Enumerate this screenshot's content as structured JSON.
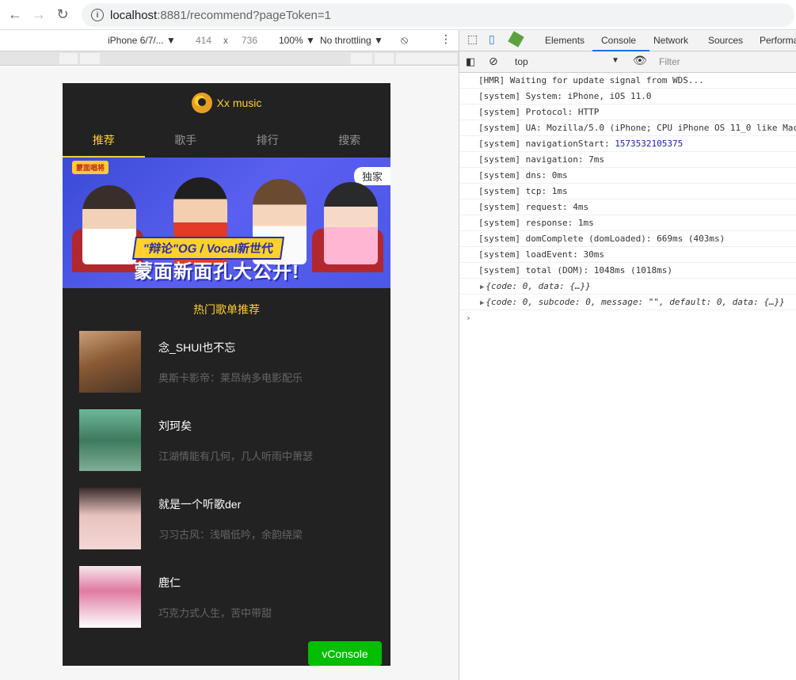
{
  "browser": {
    "url_host": "localhost",
    "url_rest": ":8881/recommend?pageToken=1"
  },
  "device_toolbar": {
    "device": "iPhone 6/7/...",
    "width": "414",
    "times": "x",
    "height": "736",
    "zoom": "100%",
    "throttle": "No throttling"
  },
  "devtools": {
    "tabs": [
      "Elements",
      "Console",
      "Network",
      "Sources",
      "Performa"
    ],
    "active_tab": "Console",
    "context": "top",
    "filter_placeholder": "Filter"
  },
  "console_lines": [
    "[HMR] Waiting for update signal from WDS...",
    "[system] System: iPhone, iOS 11.0",
    "[system] Protocol: HTTP",
    "[system] UA: Mozilla/5.0 (iPhone; CPU iPhone OS 11_0 like Mac",
    "[system] navigationStart: ",
    "[system] navigation: 7ms",
    "[system] dns: 0ms",
    "[system] tcp: 1ms",
    "[system] request: 4ms",
    "[system] response: 1ms",
    "[system] domComplete (domLoaded): 669ms (403ms)",
    "[system] loadEvent: 30ms",
    "[system] total (DOM): 1048ms (1018ms)"
  ],
  "navigation_start_value": "1573532105375",
  "console_obj1": "{code: 0, data: {…}}",
  "console_obj2": "{code: 0, subcode: 0, message: \"\", default: 0, data: {…}}",
  "app": {
    "brand": "Xx music",
    "tabs": [
      "推荐",
      "歌手",
      "排行",
      "搜索"
    ],
    "banner_badge": "独家",
    "banner_show_logo": "蒙面唱将",
    "banner_slogan": "\"辩论\"OG / Vocal新世代",
    "banner_title": "蒙面新面孔大公开!",
    "list_title": "热门歌单推荐",
    "items": [
      {
        "name": "念_SHUI也不忘",
        "desc": "奥斯卡影帝：莱昂纳多电影配乐"
      },
      {
        "name": "刘珂矣",
        "desc": "江湖情能有几何，几人听雨中萧瑟"
      },
      {
        "name": "就是一个听歌der",
        "desc": "习习古风：浅唱低吟，余韵绕梁"
      },
      {
        "name": "鹿仁",
        "desc": "巧克力式人生，苦中带甜"
      }
    ],
    "vconsole_label": "vConsole"
  },
  "colors": {
    "accent": "#ffcd32",
    "app_bg": "#222222",
    "vconsole": "#04be02"
  }
}
